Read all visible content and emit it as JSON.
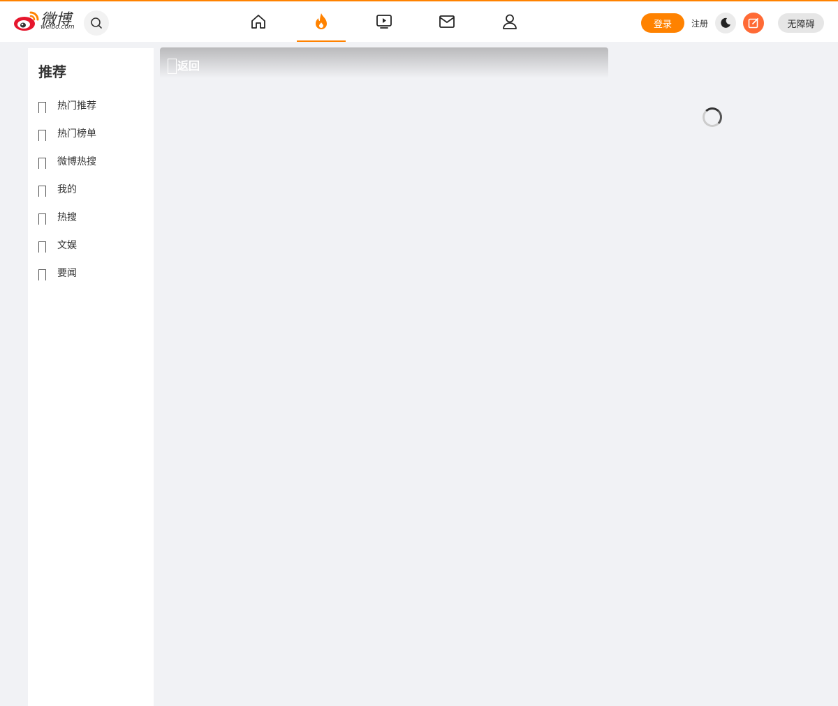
{
  "header": {
    "logo_text": "微博",
    "logo_sub": "weibo.com",
    "search_icon": "search-icon",
    "nav": [
      {
        "name": "home",
        "icon": "home-icon"
      },
      {
        "name": "hot",
        "icon": "flame-icon",
        "active": true
      },
      {
        "name": "video",
        "icon": "tv-icon"
      },
      {
        "name": "messages",
        "icon": "mail-icon"
      },
      {
        "name": "profile",
        "icon": "user-icon"
      }
    ],
    "login_label": "登录",
    "register_label": "注册",
    "theme_icon": "moon-icon",
    "compose_icon": "compose-icon",
    "accessibility_label": "无障碍",
    "accent_color": "#ff8200"
  },
  "sidebar": {
    "title": "推荐",
    "items": [
      {
        "label": "热门推荐"
      },
      {
        "label": "热门榜单"
      },
      {
        "label": "微博热搜"
      },
      {
        "label": "我的"
      },
      {
        "label": "热搜"
      },
      {
        "label": "文娱"
      },
      {
        "label": "要闻"
      }
    ]
  },
  "main": {
    "back_label": "返回"
  }
}
